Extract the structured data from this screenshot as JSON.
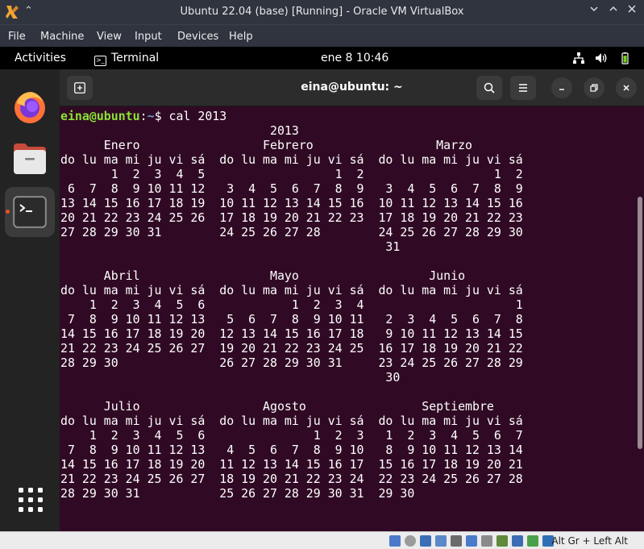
{
  "vbox": {
    "title": "Ubuntu 22.04 (base) [Running] - Oracle VM VirtualBox",
    "menu": [
      "File",
      "Machine",
      "View",
      "Input",
      "Devices",
      "Help"
    ],
    "host_key": "Alt Gr + Left Alt"
  },
  "topbar": {
    "activities": "Activities",
    "app_name": "Terminal",
    "clock": "ene 8  10:46"
  },
  "terminal": {
    "title": "eina@ubuntu: ~",
    "prompt_user": "eina@ubuntu",
    "prompt_sep": ":",
    "prompt_path": "~",
    "prompt_dollar": "$ ",
    "command": "cal 2013",
    "output": [
      "                             2013",
      "      Enero                 Febrero                 Marzo",
      "do lu ma mi ju vi sá  do lu ma mi ju vi sá  do lu ma mi ju vi sá",
      "       1  2  3  4  5                  1  2                  1  2",
      " 6  7  8  9 10 11 12   3  4  5  6  7  8  9   3  4  5  6  7  8  9",
      "13 14 15 16 17 18 19  10 11 12 13 14 15 16  10 11 12 13 14 15 16",
      "20 21 22 23 24 25 26  17 18 19 20 21 22 23  17 18 19 20 21 22 23",
      "27 28 29 30 31        24 25 26 27 28        24 25 26 27 28 29 30",
      "                                             31",
      "",
      "      Abril                  Mayo                  Junio",
      "do lu ma mi ju vi sá  do lu ma mi ju vi sá  do lu ma mi ju vi sá",
      "    1  2  3  4  5  6            1  2  3  4                     1",
      " 7  8  9 10 11 12 13   5  6  7  8  9 10 11   2  3  4  5  6  7  8",
      "14 15 16 17 18 19 20  12 13 14 15 16 17 18   9 10 11 12 13 14 15",
      "21 22 23 24 25 26 27  19 20 21 22 23 24 25  16 17 18 19 20 21 22",
      "28 29 30              26 27 28 29 30 31     23 24 25 26 27 28 29",
      "                                             30",
      "",
      "      Julio                 Agosto                Septiembre",
      "do lu ma mi ju vi sá  do lu ma mi ju vi sá  do lu ma mi ju vi sá",
      "    1  2  3  4  5  6               1  2  3   1  2  3  4  5  6  7",
      " 7  8  9 10 11 12 13   4  5  6  7  8  9 10   8  9 10 11 12 13 14",
      "14 15 16 17 18 19 20  11 12 13 14 15 16 17  15 16 17 18 19 20 21",
      "21 22 23 24 25 26 27  18 19 20 21 22 23 24  22 23 24 25 26 27 28",
      "28 29 30 31           25 26 27 28 29 30 31  29 30"
    ]
  },
  "icons": {
    "vbox_app": "virtualbox-icon",
    "keep_on_top": "double-chevron-up-icon",
    "minimize": "chevron-down-icon",
    "maximize": "chevron-up-icon",
    "close": "close-icon",
    "network": "network-icon",
    "volume": "volume-icon",
    "battery": "battery-icon",
    "firefox": "firefox-icon",
    "files": "files-icon",
    "terminal": "terminal-icon",
    "app_grid": "app-grid-icon",
    "new_tab": "new-tab-icon",
    "search": "search-icon",
    "hamburger": "menu-icon"
  },
  "colors": {
    "terminal_bg": "#300a24",
    "prompt_user": "#8ae234",
    "prompt_path": "#729fcf",
    "accent": "#e95420"
  }
}
